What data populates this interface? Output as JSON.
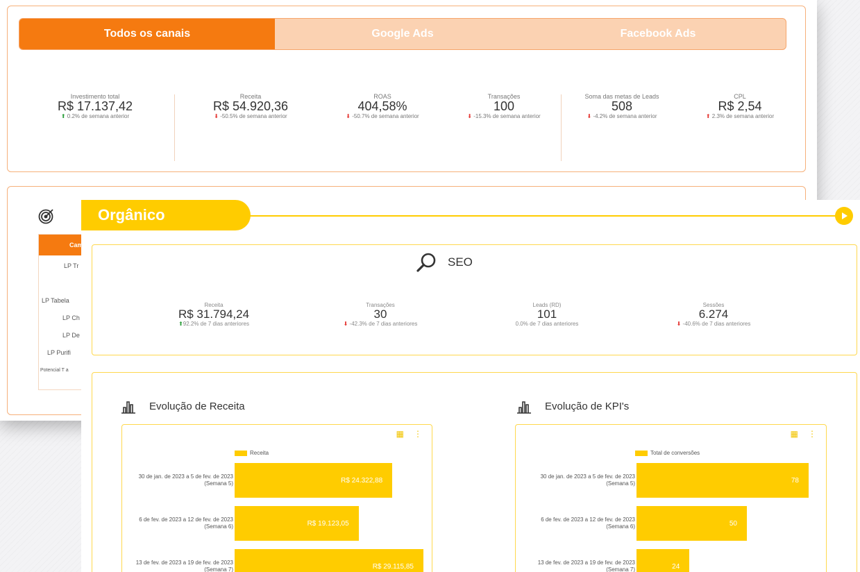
{
  "tabs": [
    "Todos os canais",
    "Google Ads",
    "Facebook Ads"
  ],
  "kpis": [
    {
      "label": "Investimento total",
      "value": "R$ 17.137,42",
      "change": "0.2% de semana anterior",
      "dir": "up"
    },
    {
      "label": "Receita",
      "value": "R$ 54.920,36",
      "change": "-50.5% de semana anterior",
      "dir": "down"
    },
    {
      "label": "ROAS",
      "value": "404,58%",
      "change": "-50.7% de semana anterior",
      "dir": "down"
    },
    {
      "label": "Transações",
      "value": "100",
      "change": "-15.3% de semana anterior",
      "dir": "down"
    },
    {
      "label": "Soma das metas de Leads",
      "value": "508",
      "change": "-4.2% de semana anterior",
      "dir": "down"
    },
    {
      "label": "CPL",
      "value": "R$ 2,54",
      "change": "2.3% de semana anterior",
      "dir": "up"
    }
  ],
  "campaigns": {
    "header": "Camp",
    "rows": [
      "LP Tr",
      "LP Tabela",
      "LP Ch",
      "LP De",
      "LP Purifi",
      "Potencial T a"
    ]
  },
  "organic": {
    "title": "Orgânico",
    "seo": {
      "title": "SEO",
      "kpis": [
        {
          "label": "Receita",
          "value": "R$ 31.794,24",
          "change": "92.2% de 7 dias anteriores",
          "dir": "up"
        },
        {
          "label": "Transações",
          "value": "30",
          "change": "-42.3% de 7 dias anteriores",
          "dir": "down"
        },
        {
          "label": "Leads (RD)",
          "value": "101",
          "change": "0.0% de 7 dias anteriores",
          "dir": "flat"
        },
        {
          "label": "Sessões",
          "value": "6.274",
          "change": "-40.6% de 7 dias anteriores",
          "dir": "down"
        }
      ]
    },
    "revenue_chart": {
      "title": "Evolução de Receita",
      "legend": "Receita",
      "categories": [
        [
          "30 de jan. de 2023 a 5 de fev. de 2023",
          "(Semana 5)"
        ],
        [
          "6 de fev. de 2023 a 12 de fev. de 2023",
          "(Semana 6)"
        ],
        [
          "13 de fev. de 2023 a 19 de fev. de 2023",
          "(Semana 7)"
        ]
      ],
      "values": [
        24322.88,
        19123.05,
        29115.85
      ],
      "value_labels": [
        "R$ 24.322,88",
        "R$ 19.123,05",
        "R$ 29.115,85"
      ]
    },
    "kpi_chart": {
      "title": "Evolução de KPI's",
      "legend": "Total de conversões",
      "categories": [
        [
          "30 de jan. de 2023 a 5 de fev. de 2023",
          "(Semana 5)"
        ],
        [
          "6 de fev. de 2023 a 12 de fev. de 2023",
          "(Semana 6)"
        ],
        [
          "13 de fev. de 2023 a 19 de fev. de 2023",
          "(Semana 7)"
        ]
      ],
      "values": [
        78,
        50,
        24
      ],
      "value_labels": [
        "78",
        "50",
        "24"
      ]
    }
  },
  "chart_data": [
    {
      "type": "bar",
      "title": "Evolução de Receita",
      "categories": [
        "30 de jan. de 2023 a 5 de fev. de 2023 (Semana 5)",
        "6 de fev. de 2023 a 12 de fev. de 2023 (Semana 6)",
        "13 de fev. de 2023 a 19 de fev. de 2023 (Semana 7)"
      ],
      "series": [
        {
          "name": "Receita",
          "values": [
            24322.88,
            19123.05,
            29115.85
          ]
        }
      ],
      "orientation": "horizontal"
    },
    {
      "type": "bar",
      "title": "Evolução de KPI's",
      "categories": [
        "30 de jan. de 2023 a 5 de fev. de 2023 (Semana 5)",
        "6 de fev. de 2023 a 12 de fev. de 2023 (Semana 6)",
        "13 de fev. de 2023 a 19 de fev. de 2023 (Semana 7)"
      ],
      "series": [
        {
          "name": "Total de conversões",
          "values": [
            78,
            50,
            24
          ]
        }
      ],
      "orientation": "horizontal"
    }
  ],
  "colors": {
    "accent_orange": "#f57a10",
    "accent_yellow": "#ffcc00",
    "up": "#2a9d3a",
    "down": "#e53935"
  }
}
